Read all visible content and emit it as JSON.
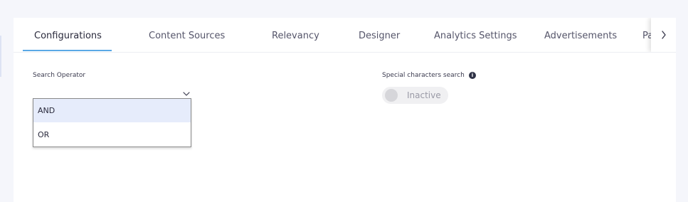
{
  "tabs": [
    {
      "label": "Configurations",
      "active": true
    },
    {
      "label": "Content Sources",
      "active": false
    },
    {
      "label": "Relevancy",
      "active": false
    },
    {
      "label": "Designer",
      "active": false
    },
    {
      "label": "Analytics Settings",
      "active": false
    },
    {
      "label": "Advertisements",
      "active": false
    },
    {
      "label": "Pa",
      "active": false
    }
  ],
  "search_operator": {
    "label": "Search Operator",
    "options": [
      "AND",
      "OR"
    ],
    "highlighted_option": "AND"
  },
  "special_characters": {
    "label": "Special characters search",
    "info_glyph": "i",
    "toggle_label": "Inactive",
    "toggle_on": false
  },
  "icons": {
    "tab_scroll": "chevron-right-icon",
    "select_toggle": "chevron-down-icon",
    "info": "info-icon"
  },
  "colors": {
    "active_underline": "#5aa9e6",
    "highlight": "#e6ecfb",
    "page_background": "#f5f6fb"
  }
}
